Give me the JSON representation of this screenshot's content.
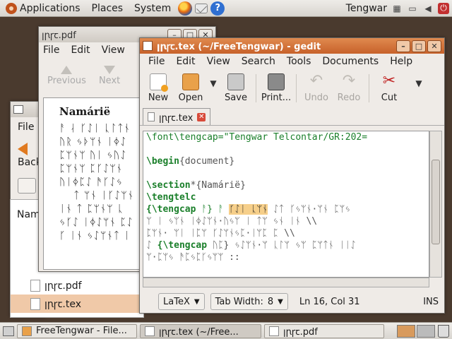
{
  "top_panel": {
    "menus": [
      "Applications",
      "Places",
      "System"
    ],
    "keyboard_layout": "Tengwar"
  },
  "pdf_window": {
    "title": "ꞁꞃꞅꞇ.pdf",
    "menus": [
      "File",
      "Edit",
      "View"
    ],
    "toolbar": {
      "previous": "Previous",
      "next": "Next"
    },
    "page_heading": "Namárië",
    "page_lines": [
      "ᚨ ᛆ ᚴᛇᛁ ᚳᛚᛏᚾ",
      "ᚢᚱ ᛃᚦᛘᚾ ᛁᛄᛇ",
      "ᛈᛘᚾᛘ ᚢᛁ ᛃᚢᛇ",
      "ᛈᛘᚾᛘ ᛈᚴᛇᛘᚾ",
      "ᚢᛁᛄᛈᛇ ᚫᚴᛇᛃ",
      "ᛏ ᛘᚾ ᛁᚴᛇᛘᚾ",
      "ᛁᚾ ᛏ ᛈᛘᚾᛘ ᚳ",
      "ᛃᚴᛇ ᛁᛄᛇᛘᚾ ᛈᛇ",
      "ᚴ ᛁᚾ ᛃᛇᛘᚾᛏ ᛁ"
    ]
  },
  "browser_window": {
    "menu_file": "File",
    "back_label": "Back",
    "column_name": "Nam",
    "files": [
      "ꞁꞃꞅꞇ.pdf",
      "ꞁꞃꞅꞇ.tex"
    ]
  },
  "gedit": {
    "title": "ꞁꞃꞅꞇ.tex (~/FreeTengwar) - gedit",
    "menus": [
      "File",
      "Edit",
      "View",
      "Search",
      "Tools",
      "Documents",
      "Help"
    ],
    "toolbar": {
      "new": "New",
      "open": "Open",
      "save": "Save",
      "print": "Print...",
      "undo": "Undo",
      "redo": "Redo",
      "cut": "Cut"
    },
    "tab_label": "ꞁꞃꞅꞇ.tex",
    "editor_lines": {
      "l0": "\\font\\tengcap=\"Tengwar Telcontar/GR:202=",
      "l1": "",
      "l2_cmd": "\\begin",
      "l2_arg": "{document}",
      "l3": "",
      "l4_cmd": "\\section",
      "l4_arg": "*{Namárië}",
      "l5": "\\tengtelc",
      "l6_cmd": "{\\tengcap ",
      "l6_a": "ᚨ} ᚨ ",
      "l6_hl": "ᚴᛇᛁ ᚳᛘᚾ",
      "l6_b": " ᛇᛏ ᚴᛃᛘᚾ·ᛘᚾ ᛈᛘᛃ",
      "l7": "ᛘ ᛁ ᛃᛘᚾ ᛁᛄᛇᛘᚾ·ᚢᛃᛘ ᛁ ᛏᛘ ᛃᚾ ᛁᚾ \\\\",
      "l8": "ᛈᛘᚾ· ᛘᛁ ᛁᛈᛘ ᚴᛇᛘᚾᛃᛈ·ᛁᛘᛈ ᛈ \\\\",
      "l9_a": "ᛇ ",
      "l9_cmd": "{\\tengcap ",
      "l9_b": "ᚢᛈ} ᛃᛇᛘᚾ·ᛘ ᚳᛚᛘ ᛃᛘ ᛈᛘᛏᚾ ᛁᛁᛇ",
      "l10": "ᛘ·ᛈᛘᛃ ᚫᛈᛃᛈᚴᛃᛘᛘ ::"
    },
    "status": {
      "language": "LaTeX",
      "tab_width_label": "Tab Width:",
      "tab_width_value": "8",
      "position": "Ln 16, Col 31",
      "mode": "INS"
    }
  },
  "taskbar": {
    "tasks": [
      "FreeTengwar - File...",
      "ꞁꞃꞅꞇ.tex (~/Free...",
      "ꞁꞃꞅꞇ.pdf"
    ]
  }
}
